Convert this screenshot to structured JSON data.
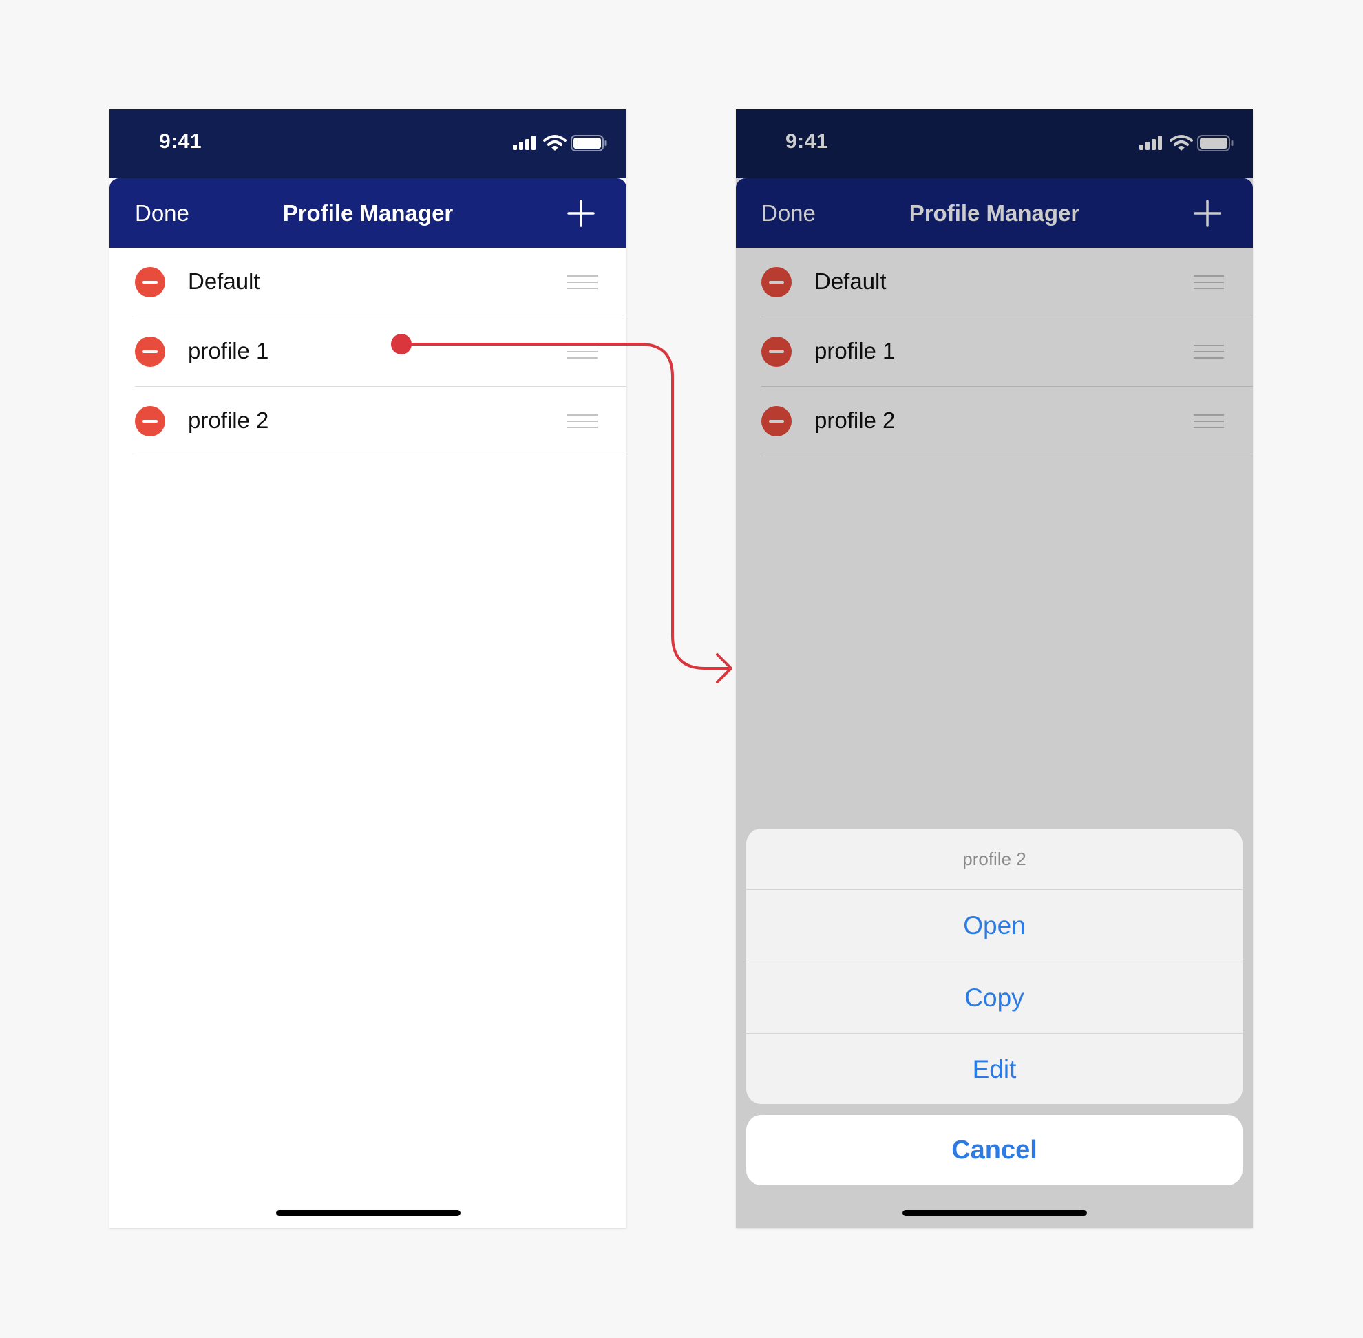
{
  "screens": {
    "left": {
      "status_time": "9:41",
      "nav": {
        "done_label": "Done",
        "title": "Profile Manager",
        "add_icon": "plus-icon"
      },
      "profiles": [
        {
          "label": "Default"
        },
        {
          "label": "profile 1"
        },
        {
          "label": "profile 2"
        }
      ]
    },
    "right": {
      "status_time": "9:41",
      "nav": {
        "done_label": "Done",
        "title": "Profile Manager",
        "add_icon": "plus-icon"
      },
      "profiles": [
        {
          "label": "Default"
        },
        {
          "label": "profile 1"
        },
        {
          "label": "profile 2"
        }
      ],
      "action_sheet": {
        "title": "profile 2",
        "actions": [
          {
            "label": "Open"
          },
          {
            "label": "Copy"
          },
          {
            "label": "Edit"
          }
        ],
        "cancel_label": "Cancel"
      }
    }
  },
  "colors": {
    "status_bar": "#111e52",
    "nav_bar": "#15247a",
    "delete": "#e84c3d",
    "action_text": "#2c7be5",
    "connector": "#d9363e"
  },
  "icons": [
    "signal-icon",
    "wifi-icon",
    "battery-icon",
    "plus-icon",
    "minus-circle-icon",
    "drag-handle-icon"
  ]
}
